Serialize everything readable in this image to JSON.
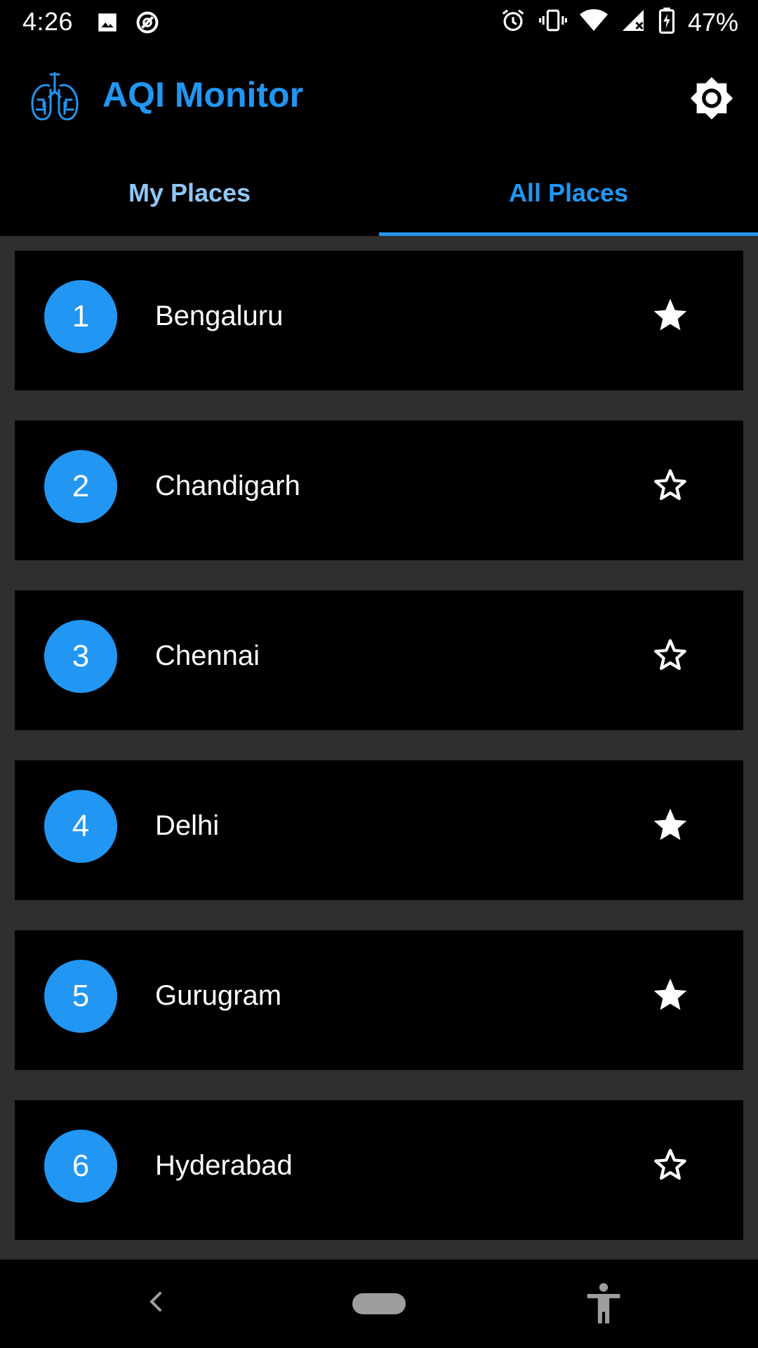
{
  "status_bar": {
    "time": "4:26",
    "battery": "47%",
    "left_icons": [
      "image-icon",
      "data-saver-icon"
    ],
    "right_icons": [
      "alarm-icon",
      "vibrate-icon",
      "wifi-icon",
      "cell-signal-icon",
      "battery-charging-icon"
    ]
  },
  "app_bar": {
    "title": "AQI Monitor",
    "logo_icon": "lungs-icon",
    "settings_icon": "brightness-icon"
  },
  "tabs": [
    {
      "label": "My Places",
      "active": false
    },
    {
      "label": "All Places",
      "active": true
    }
  ],
  "places": [
    {
      "rank": "1",
      "name": "Bengaluru",
      "starred": true
    },
    {
      "rank": "2",
      "name": "Chandigarh",
      "starred": false
    },
    {
      "rank": "3",
      "name": "Chennai",
      "starred": false
    },
    {
      "rank": "4",
      "name": "Delhi",
      "starred": true
    },
    {
      "rank": "5",
      "name": "Gurugram",
      "starred": true
    },
    {
      "rank": "6",
      "name": "Hyderabad",
      "starred": false
    }
  ],
  "nav_bar": {
    "icons": [
      "back-icon",
      "home-pill-icon",
      "accessibility-icon"
    ]
  },
  "colors": {
    "accent": "#2196F3",
    "tab_inactive": "#90C6F5",
    "background": "#000000",
    "list_background": "#2f2f2f"
  }
}
